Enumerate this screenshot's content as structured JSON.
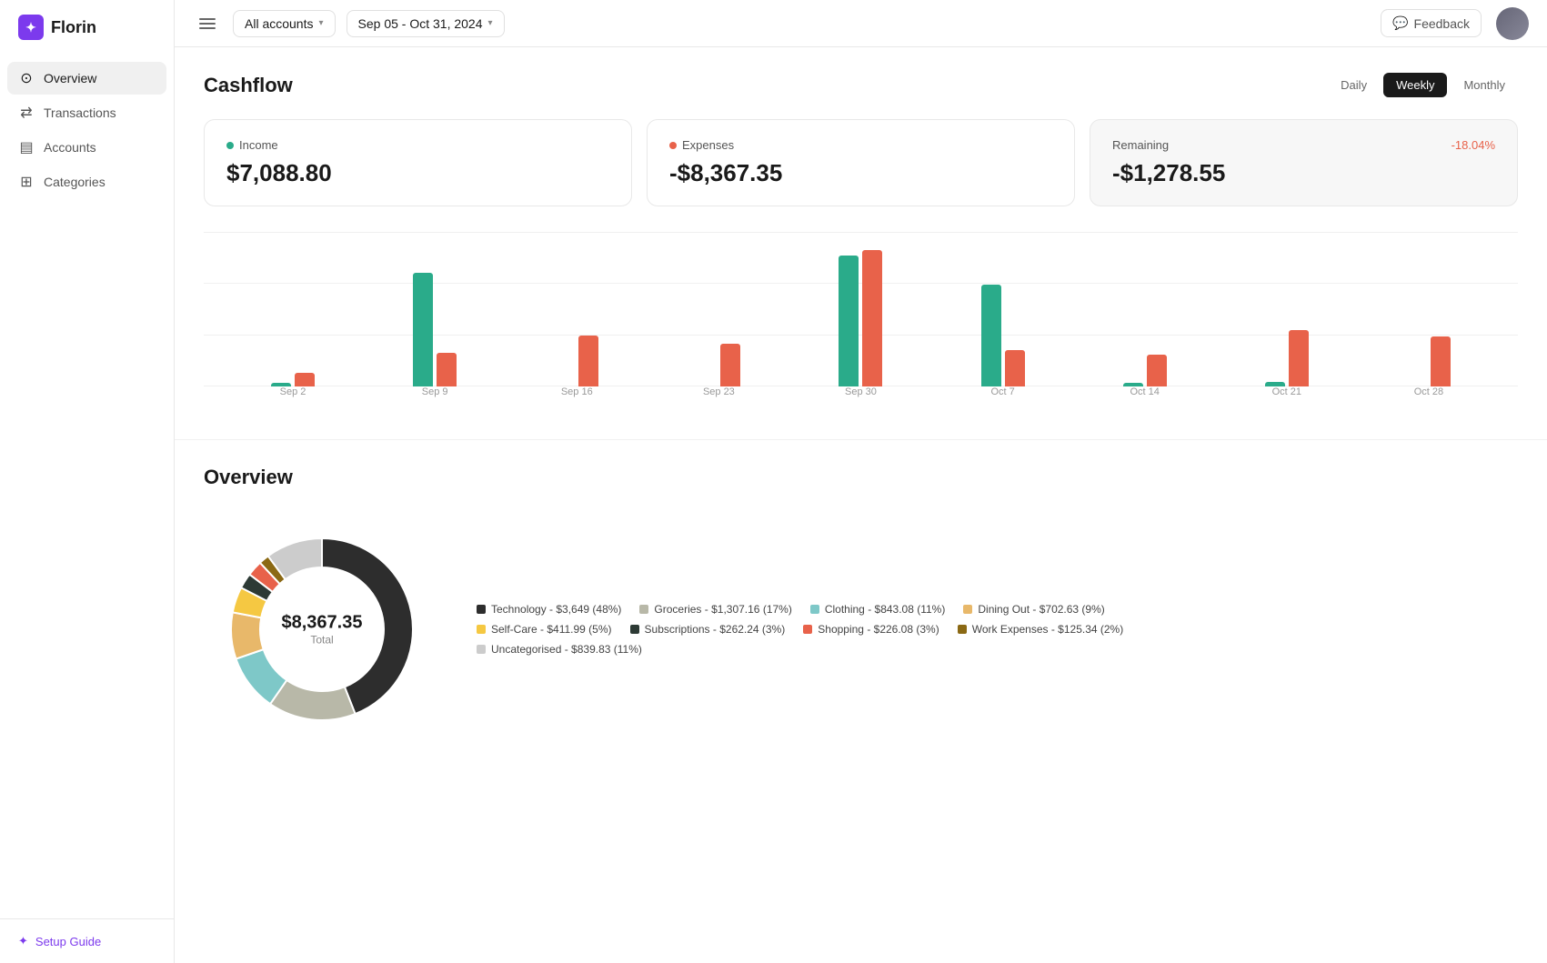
{
  "app": {
    "name": "Florin"
  },
  "topbar": {
    "accounts_label": "All accounts",
    "date_range": "Sep 05 - Oct 31, 2024",
    "feedback_label": "Feedback"
  },
  "sidebar": {
    "items": [
      {
        "id": "overview",
        "label": "Overview",
        "icon": "⊙",
        "active": true
      },
      {
        "id": "transactions",
        "label": "Transactions",
        "icon": "⇄",
        "active": false
      },
      {
        "id": "accounts",
        "label": "Accounts",
        "icon": "▤",
        "active": false
      },
      {
        "id": "categories",
        "label": "Categories",
        "icon": "⊞",
        "active": false
      }
    ],
    "setup_guide": "Setup Guide"
  },
  "cashflow": {
    "title": "Cashflow",
    "view_options": [
      "Daily",
      "Weekly",
      "Monthly"
    ],
    "active_view": "Weekly",
    "income": {
      "label": "Income",
      "amount": "$7,088.80"
    },
    "expenses": {
      "label": "Expenses",
      "amount": "-$8,367.35"
    },
    "remaining": {
      "label": "Remaining",
      "amount": "-$1,278.55",
      "percent": "-18.04%"
    },
    "chart": {
      "bars": [
        {
          "label": "Sep 2",
          "income": 3,
          "expense": 12
        },
        {
          "label": "Sep 9",
          "income": 100,
          "expense": 30
        },
        {
          "label": "Sep 16",
          "income": 0,
          "expense": 45
        },
        {
          "label": "Sep 23",
          "income": 0,
          "expense": 38
        },
        {
          "label": "Sep 30",
          "income": 115,
          "expense": 120
        },
        {
          "label": "Oct 7",
          "income": 90,
          "expense": 32
        },
        {
          "label": "Oct 14",
          "income": 3,
          "expense": 28
        },
        {
          "label": "Oct 21",
          "income": 4,
          "expense": 50
        },
        {
          "label": "Oct 28",
          "income": 0,
          "expense": 44
        }
      ]
    }
  },
  "overview": {
    "title": "Overview",
    "total_amount": "$8,367.35",
    "total_label": "Total",
    "categories": [
      {
        "label": "Technology - $3,649 (48%)",
        "color": "#2d2d2d",
        "percent": 48
      },
      {
        "label": "Groceries - $1,307.16 (17%)",
        "color": "#b0b0a0",
        "percent": 17
      },
      {
        "label": "Clothing - $843.08 (11%)",
        "color": "#7ec8c8",
        "percent": 11
      },
      {
        "label": "Dining Out - $702.63 (9%)",
        "color": "#e8b86a",
        "percent": 9
      },
      {
        "label": "Self-Care - $411.99 (5%)",
        "color": "#f5c842",
        "percent": 5
      },
      {
        "label": "Subscriptions - $262.24 (3%)",
        "color": "#2d3a35",
        "percent": 3
      },
      {
        "label": "Shopping - $226.08 (3%)",
        "color": "#e8624a",
        "percent": 3
      },
      {
        "label": "Work Expenses - $125.34 (2%)",
        "color": "#8b6914",
        "percent": 2
      },
      {
        "label": "Uncategorised - $839.83 (11%)",
        "color": "#cccccc",
        "percent": 11
      }
    ],
    "donut_colors": [
      "#2d2d2d",
      "#b8b8a8",
      "#7ec8c8",
      "#e8b86a",
      "#f5c842",
      "#2d3a35",
      "#e8624a",
      "#8b6914",
      "#cccccc"
    ]
  }
}
